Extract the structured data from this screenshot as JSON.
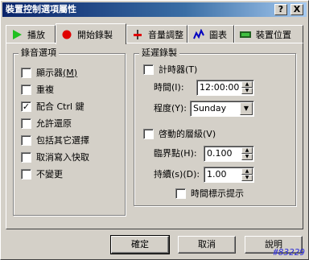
{
  "window": {
    "title": "裝置控制選項屬性"
  },
  "titlebar_buttons": {
    "help": "?",
    "close": "X"
  },
  "tabs": [
    {
      "label": "播放",
      "icon": "play-icon"
    },
    {
      "label": "開始錄製",
      "icon": "record-icon"
    },
    {
      "label": "音量調整",
      "icon": "volume-icon"
    },
    {
      "label": "圖表",
      "icon": "chart-icon"
    },
    {
      "label": "裝置位置",
      "icon": "device-icon"
    }
  ],
  "active_tab": "開始錄製",
  "recording_options": {
    "legend": "錄音選項",
    "items": [
      {
        "label": "顯示器",
        "hotkey": "(M)",
        "checked": false
      },
      {
        "label": "重複",
        "checked": false
      },
      {
        "label": "配合 Ctrl 鍵",
        "checked": true
      },
      {
        "label": "允許還原",
        "checked": false
      },
      {
        "label": "包括其它選擇",
        "checked": false
      },
      {
        "label": "取消寫入快取",
        "checked": false
      },
      {
        "label": "不變更",
        "checked": false
      }
    ]
  },
  "delayed_recording": {
    "legend": "延遲錄製",
    "timer": {
      "label": "計時器",
      "hotkey": "(T)",
      "checked": false
    },
    "time": {
      "label": "時間",
      "hotkey": "(I):",
      "value": "12:00:00"
    },
    "degree": {
      "label": "程度",
      "hotkey": "(Y):",
      "value": "Sunday"
    },
    "threshold_check": {
      "label": "啓動的層級",
      "hotkey": "(V)",
      "checked": false
    },
    "threshold": {
      "label": "臨界點",
      "hotkey": "(H):",
      "value": "0.100"
    },
    "duration": {
      "label": "持續",
      "hotkey": "(s)(D):",
      "value": "1.00"
    },
    "show_time": {
      "label": "時間標示提示",
      "checked": false
    }
  },
  "buttons": {
    "ok": "確定",
    "cancel": "取消",
    "help": "說明"
  },
  "watermark": "#83229"
}
